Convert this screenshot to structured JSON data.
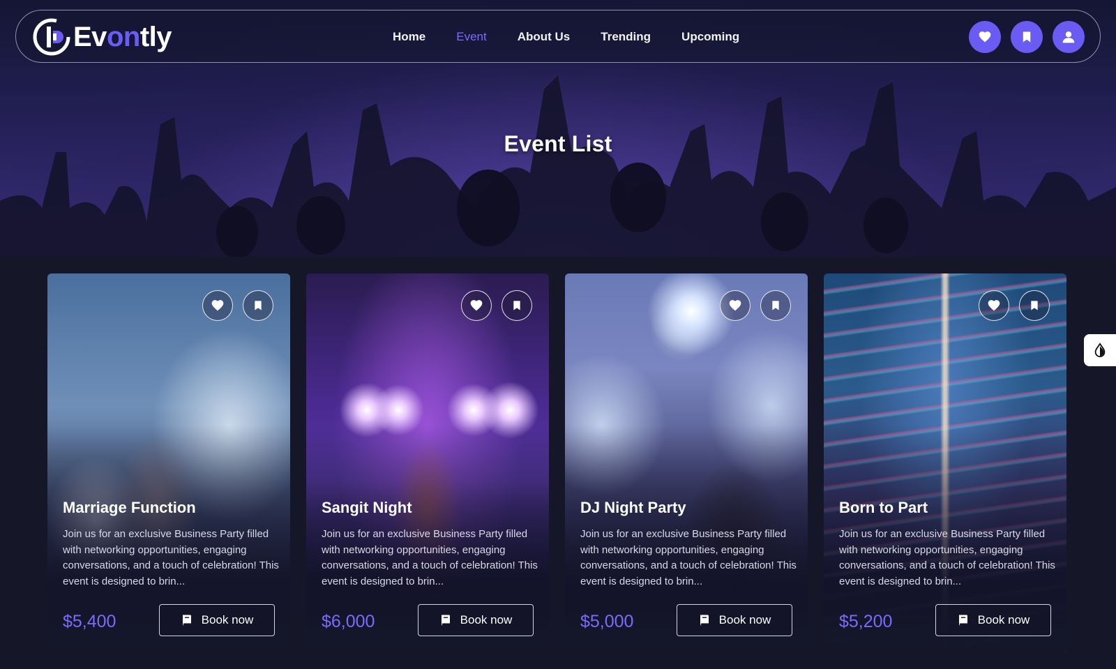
{
  "brand": {
    "name_prefix": "Ev",
    "name_accent": "on",
    "name_suffix": "tly",
    "accent_color": "#6a5cf2"
  },
  "nav": {
    "links": [
      {
        "label": "Home",
        "active": false
      },
      {
        "label": "Event",
        "active": true
      },
      {
        "label": "About Us",
        "active": false
      },
      {
        "label": "Trending",
        "active": false
      },
      {
        "label": "Upcoming",
        "active": false
      }
    ],
    "actions": [
      "heart-icon",
      "bookmark-icon",
      "user-icon"
    ]
  },
  "hero": {
    "title": "Event List"
  },
  "events": [
    {
      "title": "Marriage Function",
      "description": "Join us for an exclusive Business Party filled with networking opportunities, engaging conversations, and a touch of celebration! This event is designed to brin...",
      "price": "$5,400",
      "book_label": "Book now"
    },
    {
      "title": "Sangit Night",
      "description": "Join us for an exclusive Business Party filled with networking opportunities, engaging conversations, and a touch of celebration! This event is designed to brin...",
      "price": "$6,000",
      "book_label": "Book now"
    },
    {
      "title": "DJ Night Party",
      "description": "Join us for an exclusive Business Party filled with networking opportunities, engaging conversations, and a touch of celebration! This event is designed to brin...",
      "price": "$5,000",
      "book_label": "Book now"
    },
    {
      "title": "Born to Part",
      "description": "Join us for an exclusive Business Party filled with networking opportunities, engaging conversations, and a touch of celebration! This event is designed to brin...",
      "price": "$5,200",
      "book_label": "Book now"
    }
  ],
  "colors": {
    "page_bg": "#151729",
    "price": "#7a6bff",
    "active_nav": "#7b6cff"
  }
}
